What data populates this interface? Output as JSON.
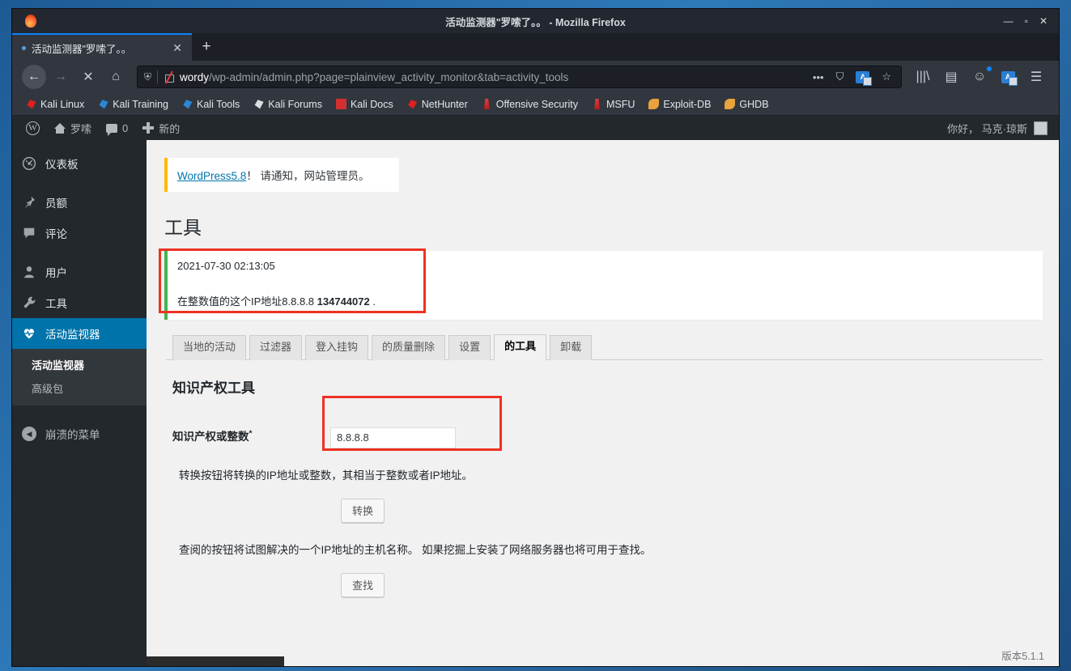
{
  "window": {
    "title": "活动监测器\"罗嗦了。。 - Mozilla Firefox",
    "minimize": "—",
    "maximize": "▫",
    "close": "✕"
  },
  "tabbar": {
    "tab_title": "活动监测器\"罗嗦了。。",
    "close_label": "✕",
    "newtab_label": "+"
  },
  "navbar": {
    "back": "←",
    "forward": "→",
    "stop": "✕",
    "home": "⌂",
    "url_host": "wordy",
    "url_path": "/wp-admin/admin.php?page=plainview_activity_monitor&tab=activity_tools",
    "url_full": "wordy/wp-admin/admin.php?page=plainview_activity_monitor&tab=activity_tools",
    "more": "•••",
    "pocket": "⛉",
    "translate": "A",
    "bookmark_star": "☆",
    "library": "|||\\",
    "sidebar": "▤",
    "account": "☺",
    "menu": "☰"
  },
  "bookmarks": [
    {
      "label": "Kali Linux",
      "icon": "kali-dragon-icon"
    },
    {
      "label": "Kali Training",
      "icon": "kali-dragon-blue-icon"
    },
    {
      "label": "Kali Tools",
      "icon": "kali-dragon-blue-icon"
    },
    {
      "label": "Kali Forums",
      "icon": "kali-dragon-bw-icon"
    },
    {
      "label": "Kali Docs",
      "icon": "kali-docs-icon"
    },
    {
      "label": "NetHunter",
      "icon": "nethunter-icon"
    },
    {
      "label": "Offensive Security",
      "icon": "offsec-tower-icon"
    },
    {
      "label": "MSFU",
      "icon": "msfu-tower-icon"
    },
    {
      "label": "Exploit-DB",
      "icon": "exploitdb-spider-icon"
    },
    {
      "label": "GHDB",
      "icon": "ghdb-spider-icon"
    }
  ],
  "adminbar": {
    "site_name": "罗嗦",
    "comment_count": "0",
    "new_label": "新的",
    "greeting": "你好， 马克·琼斯"
  },
  "sidebar": {
    "items": [
      {
        "label": "仪表板",
        "icon": "dashboard-icon",
        "active": false
      },
      {
        "label": "员额",
        "icon": "pin-icon",
        "active": false
      },
      {
        "label": "评论",
        "icon": "comment-icon",
        "active": false
      },
      {
        "label": "用户",
        "icon": "user-icon",
        "active": false
      },
      {
        "label": "工具",
        "icon": "wrench-icon",
        "active": false
      },
      {
        "label": "活动监视器",
        "icon": "heart-pulse-icon",
        "active": true
      }
    ],
    "submenu": [
      {
        "label": "活动监视器",
        "current": true
      },
      {
        "label": "高级包",
        "current": false
      }
    ],
    "collapse": {
      "label": "崩溃的菜单",
      "icon": "collapse-arrow-icon"
    }
  },
  "content": {
    "update_notice": {
      "link": "WordPress5.8",
      "rest": "！ 请通知，网站管理员。"
    },
    "page_title": "工具",
    "result_notice": {
      "timestamp": "2021-07-30 02:13:05",
      "text_prefix": "在整数值的这个IP地址8.8.8.8 ",
      "value": "134744072",
      "text_suffix": " ."
    },
    "tabs": [
      {
        "label": "当地的活动",
        "active": false
      },
      {
        "label": "过滤器",
        "active": false
      },
      {
        "label": "登入挂钩",
        "active": false
      },
      {
        "label": "的质量删除",
        "active": false
      },
      {
        "label": "设置",
        "active": false
      },
      {
        "label": "的工具",
        "active": true
      },
      {
        "label": "卸载",
        "active": false
      }
    ],
    "section_title": "知识产权工具",
    "form": {
      "label": "知识产权或整数",
      "required_mark": "*",
      "input_value": "8.8.8.8",
      "input_placeholder": ""
    },
    "convert_help": "转换按钮将转换的IP地址或整数，其相当于整数或者IP地址。",
    "convert_button": "转换",
    "lookup_help": "查阅的按钮将试图解决的一个IP地址的主机名称。 如果挖掘上安装了网络服务器也将可用于查找。",
    "lookup_button": "查找",
    "version_footer": "版本5.1.1"
  },
  "colors": {
    "wp_blue": "#0073aa",
    "wp_dark": "#23282d",
    "highlight_red": "#ee3124",
    "notice_yellow": "#ffb900",
    "notice_green": "#46b450"
  }
}
